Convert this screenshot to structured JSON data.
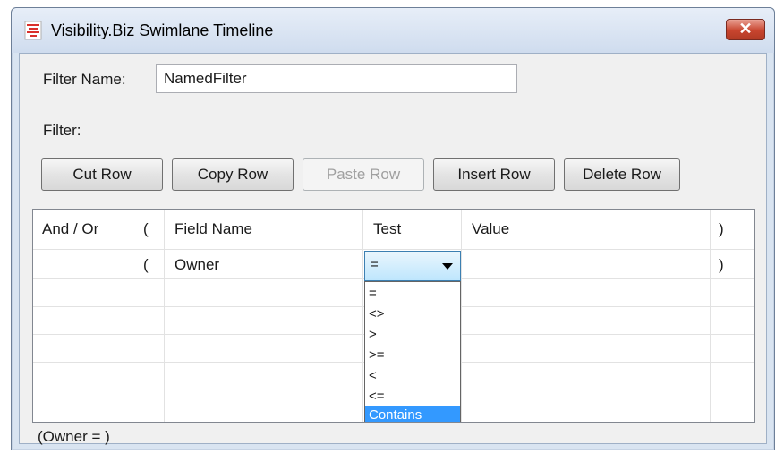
{
  "window": {
    "title": "Visibility.Biz Swimlane Timeline",
    "close_label": "✕"
  },
  "form": {
    "filter_name_label": "Filter Name:",
    "filter_name_value": "NamedFilter",
    "filter_label": "Filter:"
  },
  "toolbar": {
    "cut_label": "Cut Row",
    "copy_label": "Copy Row",
    "paste_label": "Paste Row",
    "insert_label": "Insert Row",
    "delete_label": "Delete Row"
  },
  "grid": {
    "columns": [
      "And / Or",
      "(",
      "Field Name",
      "Test",
      "Value",
      ")"
    ],
    "rows": [
      {
        "and_or": "",
        "open_paren": "(",
        "field_name": "Owner",
        "test": "=",
        "value": "",
        "close_paren": ")"
      }
    ]
  },
  "dropdown": {
    "options": [
      "=",
      "<>",
      ">",
      ">=",
      "<",
      "<=",
      "Contains"
    ],
    "highlighted": "Contains"
  },
  "expression": "(Owner = )",
  "colors": {
    "selection": "#3399ff",
    "close_button": "#c8452f"
  }
}
